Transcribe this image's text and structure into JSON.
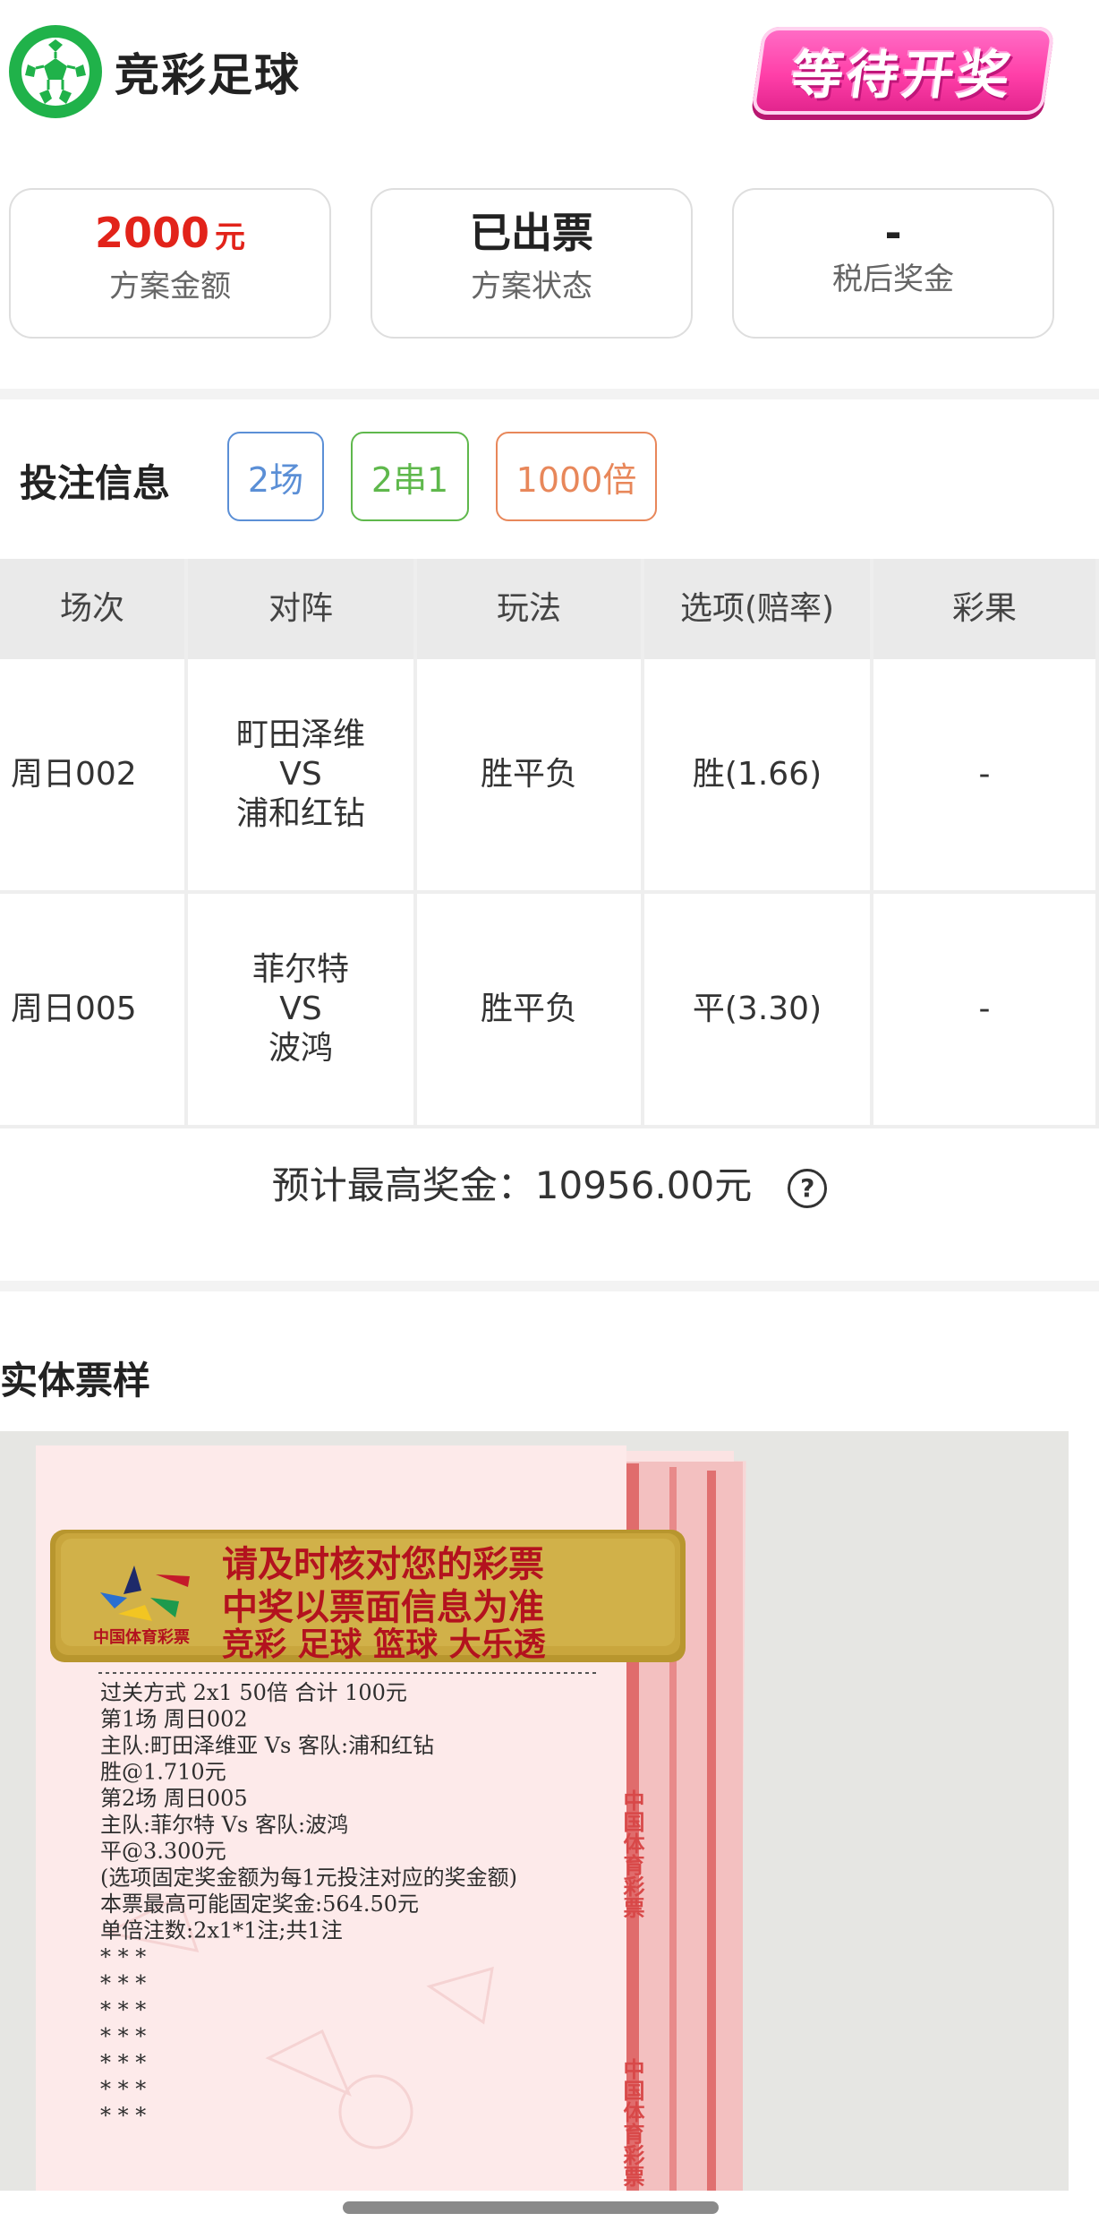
{
  "header": {
    "app_title": "竞彩足球",
    "status_stamp": "等待开奖"
  },
  "summary": {
    "amount_value": "2000",
    "amount_unit": "元",
    "amount_label": "方案金额",
    "status_value": "已出票",
    "status_label": "方案状态",
    "prize_value": "-",
    "prize_label": "税后奖金"
  },
  "bet_info": {
    "title": "投注信息",
    "tags": [
      "2场",
      "2串1",
      "1000倍"
    ],
    "tag_colors": [
      "#5b8fd6",
      "#5fb84c",
      "#e8875a"
    ],
    "columns": [
      "场次",
      "对阵",
      "玩法",
      "选项(赔率)",
      "彩果"
    ],
    "rows": [
      {
        "match_no": "周日002",
        "home": "町田泽维",
        "vs": "VS",
        "away": "浦和红钻",
        "play": "胜平负",
        "option": "胜(1.66)",
        "result": "-"
      },
      {
        "match_no": "周日005",
        "home": "菲尔特",
        "vs": "VS",
        "away": "波鸿",
        "play": "胜平负",
        "option": "平(3.30)",
        "result": "-"
      }
    ],
    "max_prize": "预计最高奖金：10956.00元",
    "help_glyph": "?"
  },
  "sample": {
    "title": "实体票样",
    "plate_line1": "请及时核对您的彩票",
    "plate_line2": "中奖以票面信息为准",
    "plate_brand": "中国体育彩票",
    "plate_line3": "竞彩  足球  篮球 大乐透",
    "side_text": "中国体育彩票",
    "ticket_lines": [
      "过关方式 2x1        50倍          合计 100元",
      "第1场   周日002",
      "主队:町田泽维亚 Vs 客队:浦和红钻",
      "胜@1.710元",
      "第2场   周日005",
      "主队:菲尔特 Vs 客队:波鸿",
      "平@3.300元",
      "(选项固定奖金额为每1元投注对应的奖金额)",
      "本票最高可能固定奖金:564.50元",
      "单倍注数:2x1*1注;共1注",
      "*  *  *",
      "*  *  *",
      "*  *  *",
      "*  *  *",
      "*  *  *",
      "*  *  *",
      "*  *  *"
    ]
  },
  "colors": {
    "accent_green": "#20b24a",
    "amount_red": "#e2231a",
    "stamp_pink": "#ff3fa8"
  }
}
